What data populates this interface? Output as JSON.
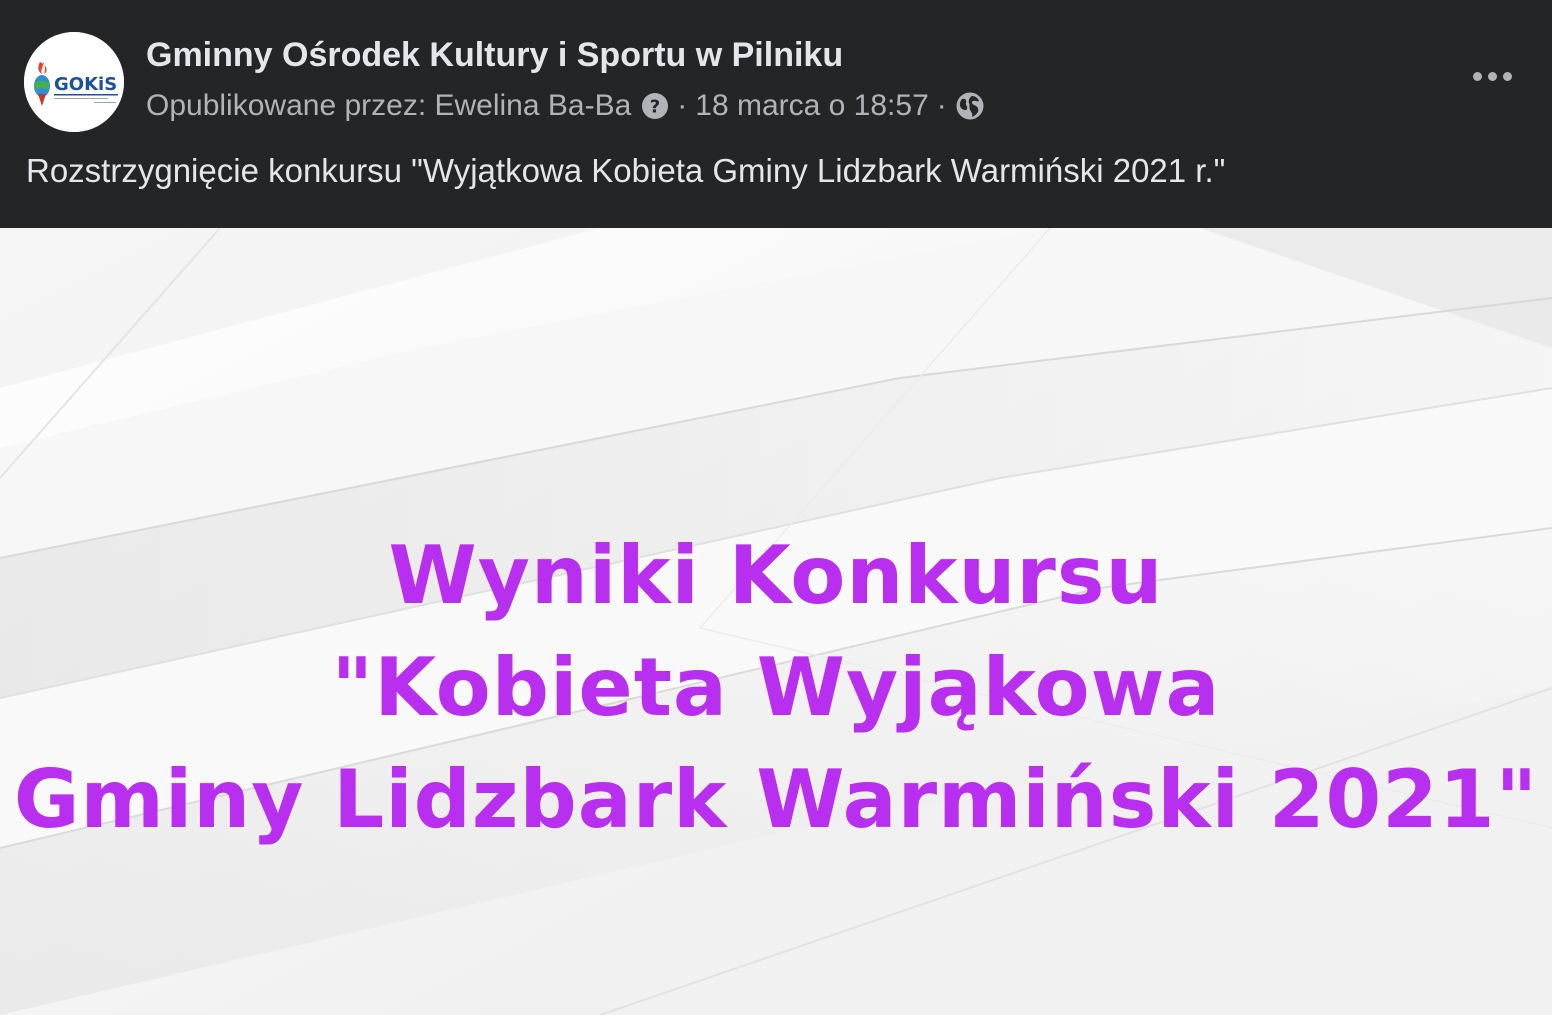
{
  "post": {
    "avatar_logo_text": "GOKiS",
    "page_name": "Gminny Ośrodek Kultury i Sportu w Pilniku",
    "meta": {
      "published_by": "Opublikowane przez: Ewelina Ba-Ba",
      "separator": "·",
      "timestamp": "18 marca o 18:57",
      "help_icon": "question-circle-icon",
      "audience_icon": "globe-icon"
    },
    "more_icon": "more-horizontal-icon",
    "text": "Rozstrzygnięcie konkursu \"Wyjątkowa Kobieta Gminy Lidzbark Warmiński 2021 r.\"",
    "image": {
      "lines": [
        "Wyniki Konkursu",
        "\"Kobieta Wyjąkowa",
        "Gminy Lidzbark Warmiński 2021\""
      ],
      "text_color": "#b82ff0",
      "background_color": "#f4f4f4"
    }
  },
  "colors": {
    "card_background": "#242526",
    "primary_text": "#e4e6eb",
    "secondary_text": "#b0b3b8"
  }
}
